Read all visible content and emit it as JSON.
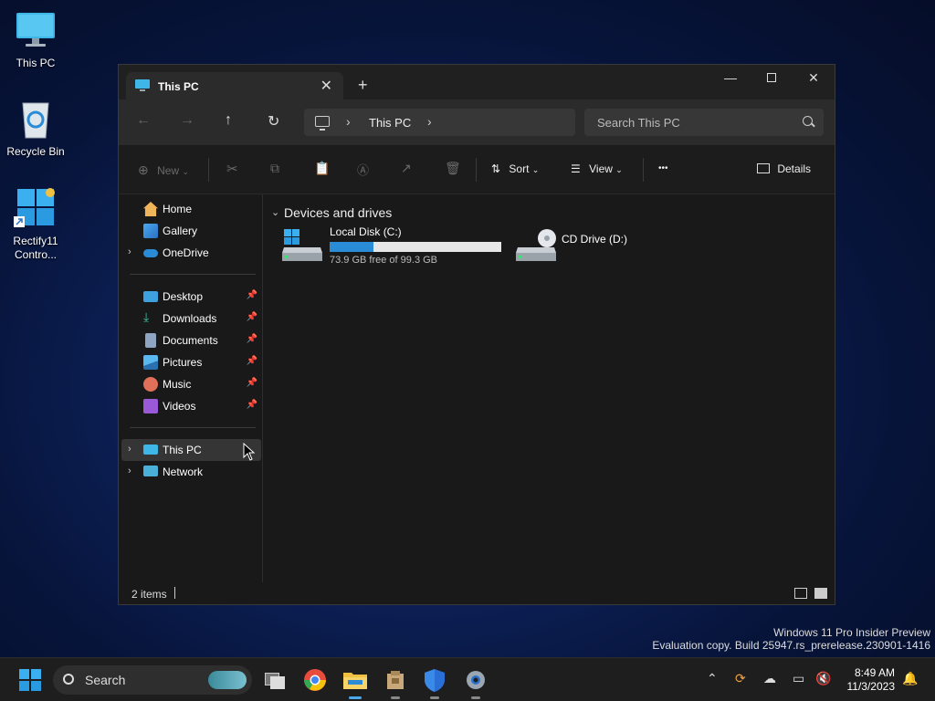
{
  "desktop": {
    "icons": [
      {
        "label": "This PC"
      },
      {
        "label": "Recycle Bin"
      },
      {
        "label": "Rectify11 Contro..."
      }
    ]
  },
  "window": {
    "tab_title": "This PC",
    "new_tab_symbol": "+",
    "address": {
      "location": "This PC"
    },
    "search_placeholder": "Search This PC",
    "commands": {
      "new": "New",
      "sort": "Sort",
      "view": "View",
      "more": "•••",
      "details": "Details"
    },
    "sidebar": {
      "items": [
        {
          "label": "Home",
          "icon": "home-icon"
        },
        {
          "label": "Gallery",
          "icon": "gallery-icon"
        },
        {
          "label": "OneDrive",
          "icon": "onedrive-icon"
        },
        {
          "label": "Desktop",
          "icon": "desktop-folder-icon"
        },
        {
          "label": "Downloads",
          "icon": "downloads-icon"
        },
        {
          "label": "Documents",
          "icon": "documents-icon"
        },
        {
          "label": "Pictures",
          "icon": "pictures-icon"
        },
        {
          "label": "Music",
          "icon": "music-icon"
        },
        {
          "label": "Videos",
          "icon": "videos-icon"
        },
        {
          "label": "This PC",
          "icon": "this-pc-icon",
          "selected": true
        },
        {
          "label": "Network",
          "icon": "network-icon"
        }
      ]
    },
    "content": {
      "group_title": "Devices and drives",
      "drives": [
        {
          "name": "Local Disk (C:)",
          "free_text": "73.9 GB free of 99.3 GB",
          "used_fraction": 0.256
        },
        {
          "name": "CD Drive (D:)"
        }
      ]
    },
    "status": {
      "items": "2 items"
    }
  },
  "watermark": {
    "line1": "Windows 11 Pro Insider Preview",
    "line2": "Evaluation copy. Build 25947.rs_prerelease.230901-1416"
  },
  "taskbar": {
    "search_placeholder": "Search",
    "time": "8:49 AM",
    "date": "11/3/2023"
  },
  "colors": {
    "accent": "#2a8bd6",
    "window_bg": "#191919",
    "titlebar_bg": "#202020"
  }
}
